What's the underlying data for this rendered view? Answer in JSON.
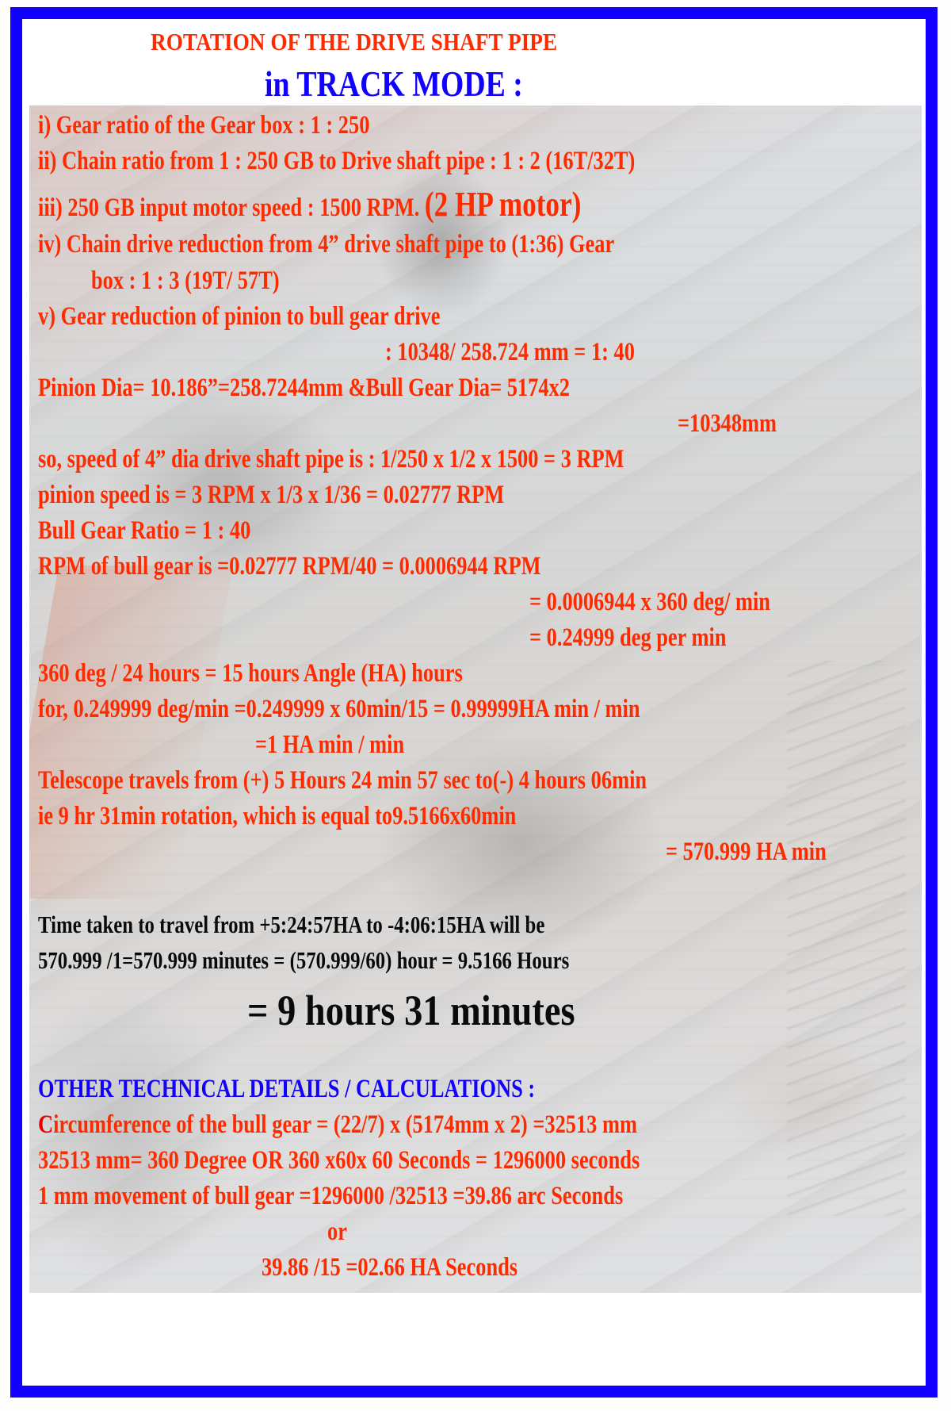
{
  "colors": {
    "frame": "#1100ff",
    "text_red": "#ff2b00",
    "text_blue": "#1100ff",
    "text_black": "#0a0a0a"
  },
  "title": {
    "line1": "ROTATION  OF  THE  DRIVE  SHAFT  PIPE",
    "line2": "in  TRACK  MODE :"
  },
  "items": {
    "i": "i)  Gear ratio of the Gear box : 1 : 250",
    "ii": "ii)  Chain  ratio from 1 : 250 GB to Drive shaft pipe : 1 : 2 (16T/32T)",
    "iii_main": "iii)  250  GB input motor speed  : 1500 RPM.",
    "iii_emph": "(2 HP  motor)",
    "iv_line1": "iv)  Chain drive reduction from 4” drive shaft pipe to (1:36) Gear",
    "iv_line2": "box : 1 : 3 (19T/ 57T)",
    "v_line1": "v)   Gear reduction of pinion to bull gear drive",
    "v_line2": ": 10348/ 258.724 mm = 1: 40"
  },
  "calculations": [
    "Pinion Dia= 10.186”=258.7244mm &Bull Gear Dia= 5174x2",
    "=10348mm",
    "so, speed of 4” dia drive shaft pipe is : 1/250 x 1/2 x 1500 = 3 RPM",
    "pinion speed is = 3 RPM x 1/3 x 1/36  = 0.02777 RPM",
    "Bull Gear Ratio = 1 : 40",
    "RPM of bull gear is =0.02777 RPM/40 = 0.0006944 RPM",
    "= 0.0006944 x 360 deg/ min",
    "= 0.24999 deg per min",
    "360 deg / 24 hours = 15 hours Angle (HA) hours",
    "for, 0.249999 deg/min =0.249999 x 60min/15 = 0.99999HA min / min",
    "=1  HA min / min",
    "Telescope travels from (+) 5 Hours 24 min 57 sec to(-) 4 hours 06min",
    "ie 9 hr 31min rotation, which is equal to9.5166x60min",
    "= 570.999 HA min"
  ],
  "time_taken": {
    "line1": "Time taken to travel from +5:24:57HA to -4:06:15HA will be",
    "line2": "570.999 /1=570.999 minutes = (570.999/60) hour = 9.5166 Hours",
    "result": "= 9 hours 31 minutes"
  },
  "other": {
    "heading": "OTHER TECHNICAL DETAILS / CALCULATIONS :",
    "circ_first_letter": "C",
    "circ_rest": "ircumference of the bull gear = (22/7) x (5174mm x 2) =32513 mm",
    "line2": "32513 mm= 360 Degree OR 360 x60x 60 Seconds = 1296000 seconds",
    "line3": "1 mm movement of bull gear =1296000 /32513 =39.86 arc Seconds",
    "or": "or",
    "line4": "39.86 /15  =02.66 HA Seconds"
  }
}
